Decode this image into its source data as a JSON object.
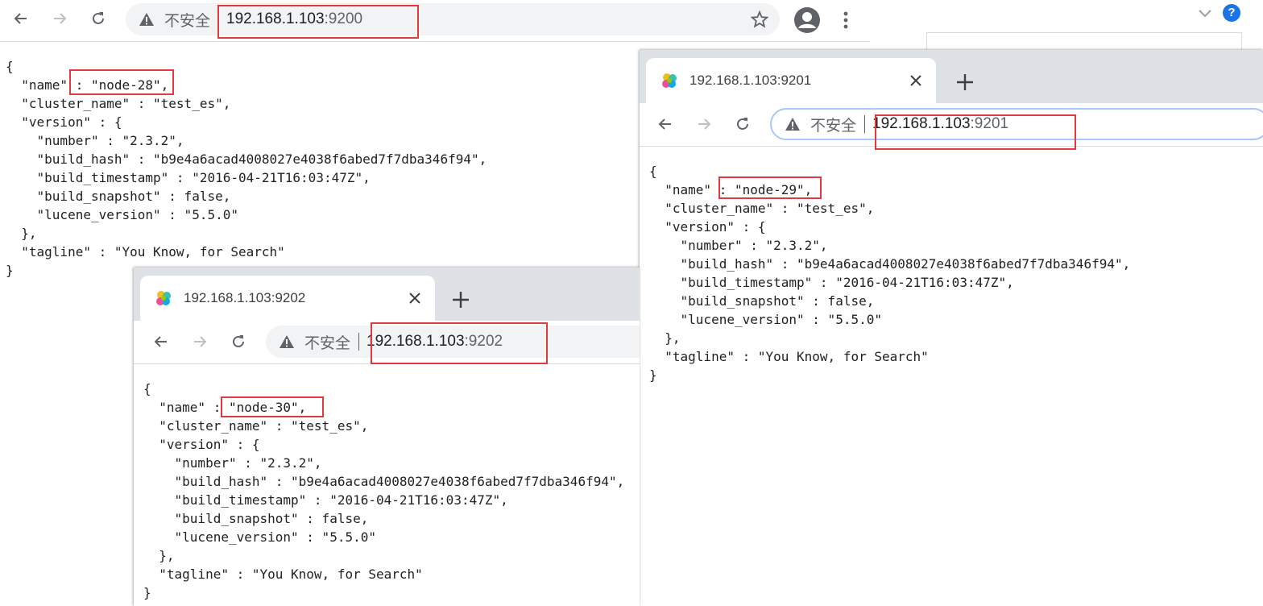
{
  "windows": {
    "w9200": {
      "tab_title": "",
      "insecure_label": "不安全",
      "url_host": "192.168.1.103",
      "url_port": ":9200",
      "json_body": "{\n  \"name\" : \"node-28\",\n  \"cluster_name\" : \"test_es\",\n  \"version\" : {\n    \"number\" : \"2.3.2\",\n    \"build_hash\" : \"b9e4a6acad4008027e4038f6abed7f7dba346f94\",\n    \"build_timestamp\" : \"2016-04-21T16:03:47Z\",\n    \"build_snapshot\" : false,\n    \"lucene_version\" : \"5.5.0\"\n  },\n  \"tagline\" : \"You Know, for Search\"\n}"
    },
    "w9201": {
      "tab_title": "192.168.1.103:9201",
      "insecure_label": "不安全",
      "url_host": "192.168.1.103",
      "url_port": ":9201",
      "json_body": "{\n  \"name\" : \"node-29\",\n  \"cluster_name\" : \"test_es\",\n  \"version\" : {\n    \"number\" : \"2.3.2\",\n    \"build_hash\" : \"b9e4a6acad4008027e4038f6abed7f7dba346f94\",\n    \"build_timestamp\" : \"2016-04-21T16:03:47Z\",\n    \"build_snapshot\" : false,\n    \"lucene_version\" : \"5.5.0\"\n  },\n  \"tagline\" : \"You Know, for Search\"\n}"
    },
    "w9202": {
      "tab_title": "192.168.1.103:9202",
      "insecure_label": "不安全",
      "url_host": "192.168.1.103",
      "url_port": ":9202",
      "json_body": "{\n  \"name\" : \"node-30\",\n  \"cluster_name\" : \"test_es\",\n  \"version\" : {\n    \"number\" : \"2.3.2\",\n    \"build_hash\" : \"b9e4a6acad4008027e4038f6abed7f7dba346f94\",\n    \"build_timestamp\" : \"2016-04-21T16:03:47Z\",\n    \"build_snapshot\" : false,\n    \"lucene_version\" : \"5.5.0\"\n  },\n  \"tagline\" : \"You Know, for Search\"\n}"
    }
  },
  "colors": {
    "highlight": "#e0393e",
    "tabstrip": "#dee1e6",
    "omnibox": "#f1f3f4",
    "help_badge": "#1a73e8"
  },
  "icons": [
    "back-arrow-icon",
    "forward-arrow-icon",
    "reload-icon",
    "warning-triangle-icon",
    "star-icon",
    "account-icon",
    "more-vert-icon",
    "elastic-favicon-icon",
    "close-icon",
    "plus-icon",
    "chevron-down-icon",
    "help-icon"
  ]
}
